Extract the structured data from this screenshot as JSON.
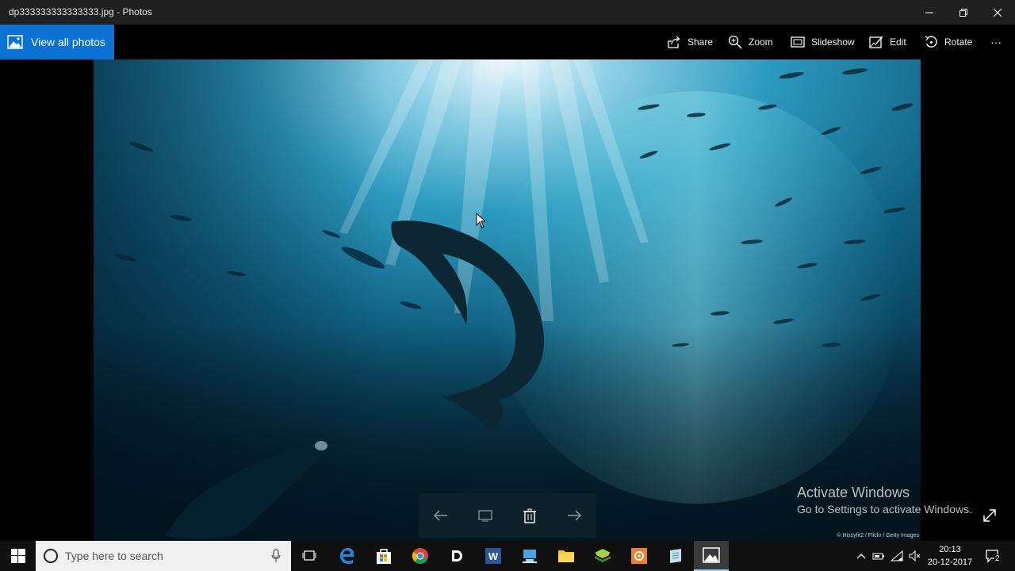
{
  "window": {
    "title": "dp333333333333333.jpg - Photos"
  },
  "toolbar": {
    "view_all": "View all photos",
    "share": "Share",
    "zoom": "Zoom",
    "slideshow": "Slideshow",
    "edit": "Edit",
    "rotate": "Rotate",
    "more": "···"
  },
  "photo": {
    "credit": "© Hissyfit2 / Flickr / Getty Images"
  },
  "watermark": {
    "line1": "Activate Windows",
    "line2": "Go to Settings to activate Windows."
  },
  "taskbar": {
    "search_placeholder": "Type here to search",
    "time": "20:13",
    "date": "20-12-2017",
    "notification_count": "2"
  },
  "colors": {
    "accent": "#0b72d4",
    "titlebar": "#1f1f1f",
    "taskbar": "#101010"
  }
}
